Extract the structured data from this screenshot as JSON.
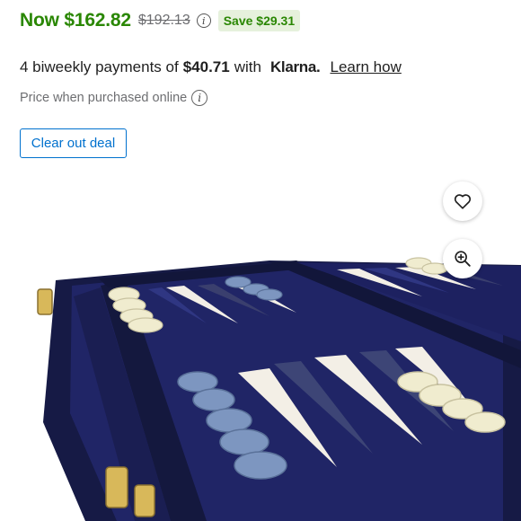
{
  "price": {
    "now": "Now $162.82",
    "was": "$192.13",
    "save": "Save $29.31",
    "info_icon": "info-icon"
  },
  "klarna": {
    "prefix": "4 biweekly payments of",
    "amount": "$40.71",
    "with": "with",
    "logo": "Klarna.",
    "link": "Learn how"
  },
  "online": {
    "text": "Price when purchased online",
    "info_icon": "info-icon"
  },
  "deal_button": {
    "label": "Clear out deal"
  },
  "image_actions": {
    "favorite_icon": "heart-icon",
    "zoom_icon": "zoom-in-icon"
  },
  "colors": {
    "price_green": "#2a8703",
    "save_bg": "#e6f1dc",
    "link_blue": "#0071ce",
    "board_navy": "#1b1f5a"
  }
}
